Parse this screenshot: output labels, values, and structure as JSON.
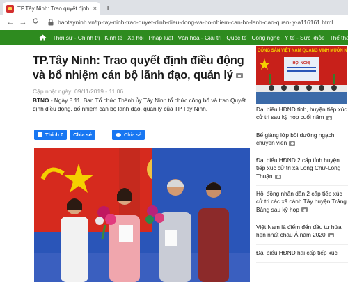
{
  "browser": {
    "tab_title": "TP.Tây Ninh: Trao quyết định điều",
    "tab_close": "×",
    "new_tab": "+",
    "back": "←",
    "forward": "→",
    "reload": "C",
    "url": "baotayninh.vn/tp-tay-ninh-trao-quyet-dinh-dieu-dong-va-bo-nhiem-can-bo-lanh-dao-quan-ly-a116161.html"
  },
  "site_nav": {
    "items": [
      "Thời sự - Chính trị",
      "Kinh tế",
      "Xã hội",
      "Pháp luật",
      "Văn hóa - Giải trí",
      "Quốc tế",
      "Công nghệ",
      "Y tế - Sức khỏe",
      "Thể thao",
      "Tr"
    ]
  },
  "article": {
    "title": "TP.Tây Ninh: Trao quyết định điều động và bổ nhiệm cán bộ lãnh đạo, quản lý",
    "date": "Cập nhật ngày: 09/11/2019 - 11:06",
    "lead_bold": "BTNO",
    "lead_text": " - Ngày 8.11, Ban Tổ chức Thành ủy Tây Ninh tổ chức công bố và trao Quyết định điều động, bổ nhiệm cán bộ lãnh đạo, quản lý của TP.Tây Ninh.",
    "fb_like": "Thích 0",
    "fb_share": "Chia sẻ",
    "zalo_share": "Chia sẻ"
  },
  "sidebar": {
    "banner_top": "CỘNG SẢN VIỆT NAM QUANG VINH MUÔN N",
    "banner_board": "HỘI NGHỊ",
    "items": [
      "Đại biểu HĐND tỉnh, huyện tiếp xúc cử tri sau kỳ họp cuối năm",
      "Bế giảng lớp bồi dưỡng ngạch chuyên viên",
      "Đại biểu HĐND 2 cấp tỉnh huyện tiếp xúc cử tri xã Long Chữ-Long Thuận",
      "Hội đồng nhân dân 2 cấp tiếp xúc cử tri các xã cánh Tây huyện Trảng Bàng sau kỳ họp",
      "Việt Nam là điểm đến đầu tư hứa hẹn nhất châu Á năm 2020",
      "Đại biểu HĐND hai cấp tiếp xúc"
    ]
  },
  "colors": {
    "nav_green": "#2e8b1f",
    "facebook_blue": "#1877f2",
    "flag_red": "#d62a1e"
  }
}
